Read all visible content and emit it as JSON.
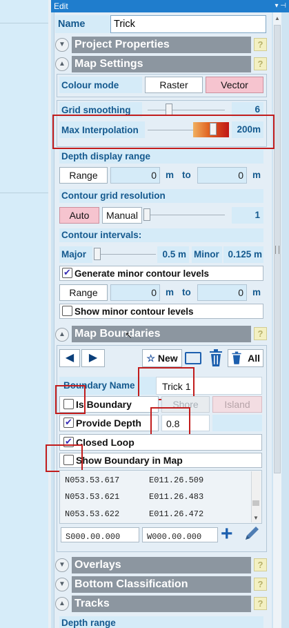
{
  "window": {
    "title": "Edit",
    "icons": "▾ ⊣"
  },
  "name": {
    "label": "Name",
    "value": "Trick"
  },
  "sections": {
    "project_properties": "Project Properties",
    "map_settings": "Map Settings",
    "map_boundaries": "Map Boundaries",
    "overlays": "Overlays",
    "bottom_classification": "Bottom Classification",
    "tracks": "Tracks",
    "help": "?"
  },
  "map_settings": {
    "colour_mode_label": "Colour mode",
    "raster": "Raster",
    "vector": "Vector",
    "grid_smoothing_label": "Grid smoothing",
    "grid_smoothing_value": "6",
    "max_interp_label": "Max Interpolation",
    "max_interp_value": "200m",
    "depth_display_range_label": "Depth display range",
    "range_btn": "Range",
    "depth_from": "0",
    "depth_to": "0",
    "unit_m": "m",
    "to": "to",
    "contour_grid_label": "Contour grid resolution",
    "auto": "Auto",
    "manual": "Manual",
    "contour_grid_value": "1",
    "contour_intervals_label": "Contour intervals:",
    "major_label": "Major",
    "major_value": "0.5 m",
    "minor_label": "Minor",
    "minor_value": "0.125 m",
    "generate_minor_label": "Generate minor contour levels",
    "range2_btn": "Range",
    "range2_from": "0",
    "range2_to": "0",
    "show_minor_label": "Show minor contour levels"
  },
  "boundaries": {
    "new_btn": "New",
    "all_btn": "All",
    "boundary_name_label": "Boundary Name",
    "boundary_name_value": "Trick 1",
    "is_boundary_label": "Is Boundary",
    "shore": "Shore",
    "island": "Island",
    "provide_depth_label": "Provide Depth",
    "provide_depth_value": "0.8",
    "closed_loop_label": "Closed Loop",
    "show_in_map_label": "Show Boundary in Map",
    "points": [
      {
        "lat": "N053.53.617",
        "lon": "E011.26.509"
      },
      {
        "lat": "N053.53.621",
        "lon": "E011.26.483"
      },
      {
        "lat": "N053.53.622",
        "lon": "E011.26.472"
      }
    ],
    "new_lat": "S000.00.000",
    "new_lon": "W000.00.000"
  },
  "tracks": {
    "depth_range_label": "Depth range"
  },
  "colors": {
    "accent": "#1f7dcd",
    "label": "#14598e",
    "pink": "#f6c4cf",
    "highlight_red": "#c11b1b"
  }
}
